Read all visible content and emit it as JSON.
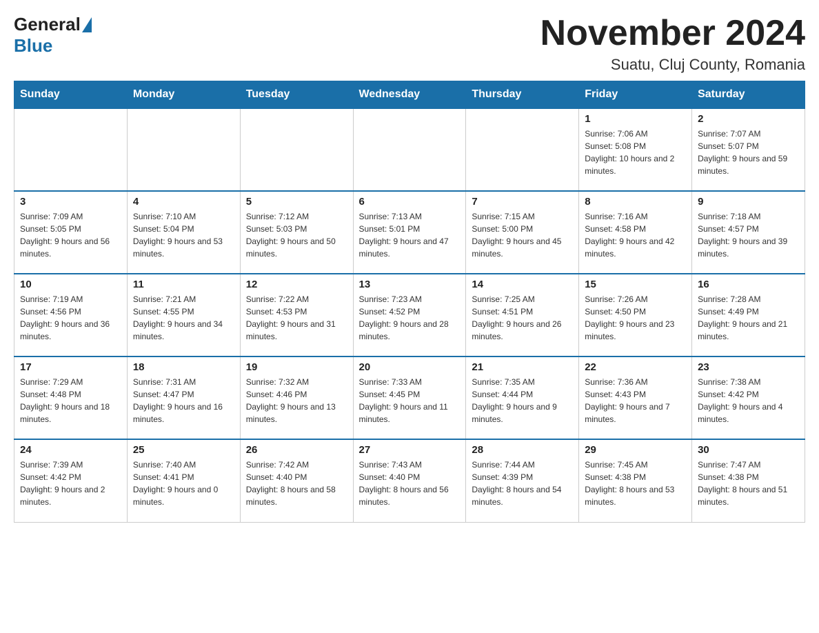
{
  "header": {
    "logo_general": "General",
    "logo_blue": "Blue",
    "month_title": "November 2024",
    "location": "Suatu, Cluj County, Romania"
  },
  "days_of_week": [
    "Sunday",
    "Monday",
    "Tuesday",
    "Wednesday",
    "Thursday",
    "Friday",
    "Saturday"
  ],
  "weeks": [
    [
      {
        "day": "",
        "info": ""
      },
      {
        "day": "",
        "info": ""
      },
      {
        "day": "",
        "info": ""
      },
      {
        "day": "",
        "info": ""
      },
      {
        "day": "",
        "info": ""
      },
      {
        "day": "1",
        "info": "Sunrise: 7:06 AM\nSunset: 5:08 PM\nDaylight: 10 hours and 2 minutes."
      },
      {
        "day": "2",
        "info": "Sunrise: 7:07 AM\nSunset: 5:07 PM\nDaylight: 9 hours and 59 minutes."
      }
    ],
    [
      {
        "day": "3",
        "info": "Sunrise: 7:09 AM\nSunset: 5:05 PM\nDaylight: 9 hours and 56 minutes."
      },
      {
        "day": "4",
        "info": "Sunrise: 7:10 AM\nSunset: 5:04 PM\nDaylight: 9 hours and 53 minutes."
      },
      {
        "day": "5",
        "info": "Sunrise: 7:12 AM\nSunset: 5:03 PM\nDaylight: 9 hours and 50 minutes."
      },
      {
        "day": "6",
        "info": "Sunrise: 7:13 AM\nSunset: 5:01 PM\nDaylight: 9 hours and 47 minutes."
      },
      {
        "day": "7",
        "info": "Sunrise: 7:15 AM\nSunset: 5:00 PM\nDaylight: 9 hours and 45 minutes."
      },
      {
        "day": "8",
        "info": "Sunrise: 7:16 AM\nSunset: 4:58 PM\nDaylight: 9 hours and 42 minutes."
      },
      {
        "day": "9",
        "info": "Sunrise: 7:18 AM\nSunset: 4:57 PM\nDaylight: 9 hours and 39 minutes."
      }
    ],
    [
      {
        "day": "10",
        "info": "Sunrise: 7:19 AM\nSunset: 4:56 PM\nDaylight: 9 hours and 36 minutes."
      },
      {
        "day": "11",
        "info": "Sunrise: 7:21 AM\nSunset: 4:55 PM\nDaylight: 9 hours and 34 minutes."
      },
      {
        "day": "12",
        "info": "Sunrise: 7:22 AM\nSunset: 4:53 PM\nDaylight: 9 hours and 31 minutes."
      },
      {
        "day": "13",
        "info": "Sunrise: 7:23 AM\nSunset: 4:52 PM\nDaylight: 9 hours and 28 minutes."
      },
      {
        "day": "14",
        "info": "Sunrise: 7:25 AM\nSunset: 4:51 PM\nDaylight: 9 hours and 26 minutes."
      },
      {
        "day": "15",
        "info": "Sunrise: 7:26 AM\nSunset: 4:50 PM\nDaylight: 9 hours and 23 minutes."
      },
      {
        "day": "16",
        "info": "Sunrise: 7:28 AM\nSunset: 4:49 PM\nDaylight: 9 hours and 21 minutes."
      }
    ],
    [
      {
        "day": "17",
        "info": "Sunrise: 7:29 AM\nSunset: 4:48 PM\nDaylight: 9 hours and 18 minutes."
      },
      {
        "day": "18",
        "info": "Sunrise: 7:31 AM\nSunset: 4:47 PM\nDaylight: 9 hours and 16 minutes."
      },
      {
        "day": "19",
        "info": "Sunrise: 7:32 AM\nSunset: 4:46 PM\nDaylight: 9 hours and 13 minutes."
      },
      {
        "day": "20",
        "info": "Sunrise: 7:33 AM\nSunset: 4:45 PM\nDaylight: 9 hours and 11 minutes."
      },
      {
        "day": "21",
        "info": "Sunrise: 7:35 AM\nSunset: 4:44 PM\nDaylight: 9 hours and 9 minutes."
      },
      {
        "day": "22",
        "info": "Sunrise: 7:36 AM\nSunset: 4:43 PM\nDaylight: 9 hours and 7 minutes."
      },
      {
        "day": "23",
        "info": "Sunrise: 7:38 AM\nSunset: 4:42 PM\nDaylight: 9 hours and 4 minutes."
      }
    ],
    [
      {
        "day": "24",
        "info": "Sunrise: 7:39 AM\nSunset: 4:42 PM\nDaylight: 9 hours and 2 minutes."
      },
      {
        "day": "25",
        "info": "Sunrise: 7:40 AM\nSunset: 4:41 PM\nDaylight: 9 hours and 0 minutes."
      },
      {
        "day": "26",
        "info": "Sunrise: 7:42 AM\nSunset: 4:40 PM\nDaylight: 8 hours and 58 minutes."
      },
      {
        "day": "27",
        "info": "Sunrise: 7:43 AM\nSunset: 4:40 PM\nDaylight: 8 hours and 56 minutes."
      },
      {
        "day": "28",
        "info": "Sunrise: 7:44 AM\nSunset: 4:39 PM\nDaylight: 8 hours and 54 minutes."
      },
      {
        "day": "29",
        "info": "Sunrise: 7:45 AM\nSunset: 4:38 PM\nDaylight: 8 hours and 53 minutes."
      },
      {
        "day": "30",
        "info": "Sunrise: 7:47 AM\nSunset: 4:38 PM\nDaylight: 8 hours and 51 minutes."
      }
    ]
  ]
}
